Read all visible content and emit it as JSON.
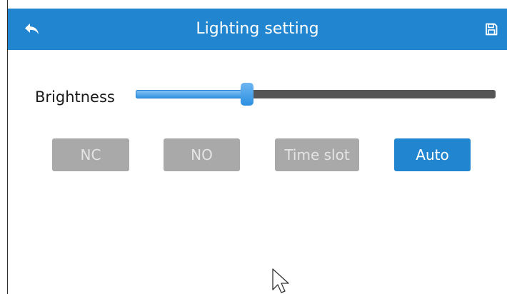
{
  "header": {
    "title": "Lighting setting",
    "back_icon": "back-arrow-icon",
    "save_icon": "save-icon",
    "color": "#2185d0"
  },
  "brightness": {
    "label": "Brightness",
    "level_fraction": 0.31
  },
  "modes": {
    "items": [
      "NC",
      "NO",
      "Time slot",
      "Auto"
    ],
    "selected": "Auto",
    "active_color": "#2185d0",
    "inactive_color": "#a9a9a9"
  }
}
